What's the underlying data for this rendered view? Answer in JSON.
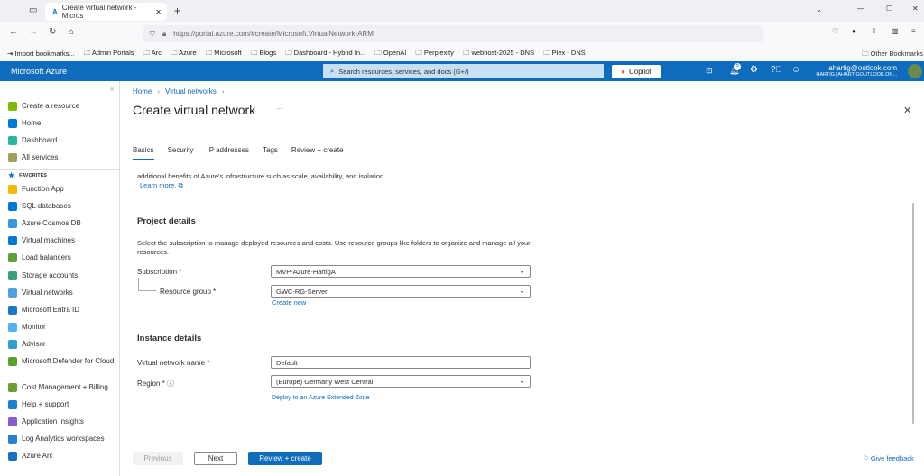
{
  "browser": {
    "tab_title": "Create virtual network - Micros",
    "url": "https://portal.azure.com/#create/Microsoft.VirtualNetwork-ARM",
    "bookmarks": [
      "Import bookmarks...",
      "Admin Portals",
      "Arc",
      "Azure",
      "Microsoft",
      "Blogs",
      "Dashboard - Hybrid In...",
      "OpenAI",
      "Perplexity",
      "webhost-2025 - DNS",
      "Plex - DNS"
    ],
    "other_bookmarks": "Other Bookmarks"
  },
  "portal": {
    "brand": "Microsoft Azure",
    "search_placeholder": "Search resources, services, and docs (G+/)",
    "copilot": "Copilot",
    "notification_count": "5",
    "user_email": "ahartig@outlook.com",
    "user_dir": "HARTIG (AHARTIGOUTLOOK.ON..."
  },
  "sidebar": {
    "top": [
      {
        "label": "Create a resource",
        "color": "#7fba00"
      },
      {
        "label": "Home",
        "color": "#0078d4"
      },
      {
        "label": "Dashboard",
        "color": "#2bb3a0"
      },
      {
        "label": "All services",
        "color": "#a0a05a"
      }
    ],
    "favorites_label": "FAVORITES",
    "items": [
      {
        "label": "Function App",
        "color": "#f5b800"
      },
      {
        "label": "SQL databases",
        "color": "#0078d4"
      },
      {
        "label": "Azure Cosmos DB",
        "color": "#3a96dd"
      },
      {
        "label": "Virtual machines",
        "color": "#0078d4"
      },
      {
        "label": "Load balancers",
        "color": "#5ea03a"
      },
      {
        "label": "Storage accounts",
        "color": "#3aa07a"
      },
      {
        "label": "Virtual networks",
        "color": "#50a0e0"
      },
      {
        "label": "Microsoft Entra ID",
        "color": "#1a78c8"
      },
      {
        "label": "Monitor",
        "color": "#50b0f0"
      },
      {
        "label": "Advisor",
        "color": "#30a0d0"
      },
      {
        "label": "Microsoft Defender for Cloud",
        "color": "#5aa02a"
      },
      {
        "label": "Cost Management + Billing",
        "color": "#6aa030"
      },
      {
        "label": "Help + support",
        "color": "#1a80d0"
      },
      {
        "label": "Application Insights",
        "color": "#8a5ad0"
      },
      {
        "label": "Log Analytics workspaces",
        "color": "#2a80d0"
      },
      {
        "label": "Azure Arc",
        "color": "#1a70c0"
      }
    ]
  },
  "main": {
    "breadcrumb": [
      "Home",
      "Virtual networks"
    ],
    "title": "Create virtual network",
    "more": "...",
    "tabs": [
      "Basics",
      "Security",
      "IP addresses",
      "Tags",
      "Review + create"
    ],
    "active_tab": "Basics",
    "intro": "additional benefits of Azure's infrastructure such as scale, availability, and isolation.",
    "learn_more": "Learn more.",
    "project_heading": "Project details",
    "project_desc": "Select the subscription to manage deployed resources and costs. Use resource groups like folders to organize and manage all your resources.",
    "subscription_label": "Subscription *",
    "subscription_value": "MVP-Azure-HartigA",
    "rg_label": "Resource group *",
    "rg_value": "GWC-RG-Server",
    "create_new": "Create new",
    "instance_heading": "Instance details",
    "vnet_label": "Virtual network name *",
    "vnet_value": "Default",
    "region_label": "Region *",
    "region_value": "(Europe) Germany West Central",
    "extended_zone": "Deploy to an Azure Extended Zone"
  },
  "footer": {
    "previous": "Previous",
    "next": "Next",
    "review": "Review + create",
    "feedback": "Give feedback"
  },
  "colors": {
    "accent": "#0f6cbd"
  }
}
